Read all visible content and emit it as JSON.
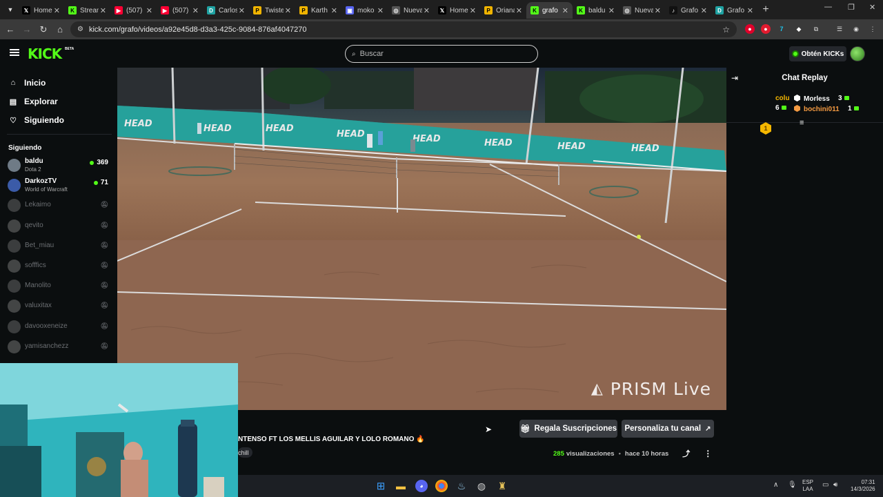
{
  "browser": {
    "tabs": [
      {
        "title": "Home",
        "icon": "x-icon",
        "color": "#000000",
        "glyph": "𝕏"
      },
      {
        "title": "Stream",
        "icon": "kick-icon",
        "color": "#53fc18",
        "glyph": "K"
      },
      {
        "title": "(507)",
        "icon": "youtube-icon",
        "color": "#ff0033",
        "glyph": "▶"
      },
      {
        "title": "(507)",
        "icon": "youtube-icon",
        "color": "#ff0033",
        "glyph": "▶"
      },
      {
        "title": "Carlos",
        "icon": "d-icon",
        "color": "#1fa2a2",
        "glyph": "D"
      },
      {
        "title": "Twister",
        "icon": "pin-icon",
        "color": "#f0b400",
        "glyph": "P"
      },
      {
        "title": "Karth",
        "icon": "pin-icon",
        "color": "#f0b400",
        "glyph": "P"
      },
      {
        "title": "moko",
        "icon": "app-icon",
        "color": "#5865f2",
        "glyph": "▣"
      },
      {
        "title": "Nueva",
        "icon": "globe-icon",
        "color": "#555555",
        "glyph": "◎"
      },
      {
        "title": "Home",
        "icon": "x-icon",
        "color": "#000000",
        "glyph": "𝕏"
      },
      {
        "title": "Oriana",
        "icon": "pin-icon",
        "color": "#f0b400",
        "glyph": "P"
      },
      {
        "title": "grafo",
        "icon": "kick-icon",
        "color": "#53fc18",
        "glyph": "K",
        "active": true
      },
      {
        "title": "baldu",
        "icon": "kick-icon",
        "color": "#53fc18",
        "glyph": "K"
      },
      {
        "title": "Nueva",
        "icon": "globe-icon",
        "color": "#555555",
        "glyph": "◎"
      },
      {
        "title": "Grafo",
        "icon": "tiktok-icon",
        "color": "#111111",
        "glyph": "♪"
      },
      {
        "title": "Grafo",
        "icon": "d-icon",
        "color": "#1fa2a2",
        "glyph": "D"
      }
    ],
    "url": "kick.com/grafo/videos/a92e45d8-d3a3-425c-9084-876af4047270"
  },
  "header": {
    "logo": "KICK",
    "beta": "BETA",
    "search_placeholder": "Buscar",
    "kicks_button": "Obtén KICKs"
  },
  "sidebar": {
    "nav": [
      {
        "label": "Inicio",
        "icon": "home-icon",
        "glyph": "⌂"
      },
      {
        "label": "Explorar",
        "icon": "compass-icon",
        "glyph": "▤"
      },
      {
        "label": "Siguiendo",
        "icon": "heart-icon",
        "glyph": "♡"
      }
    ],
    "following_title": "Siguiendo",
    "channels": [
      {
        "name": "baldu",
        "game": "Dota 2",
        "viewers": "369",
        "live": true,
        "color": "#6f7b86"
      },
      {
        "name": "DarkozTV",
        "game": "World of Warcraft",
        "viewers": "71",
        "live": true,
        "color": "#3b5ba8"
      },
      {
        "name": "Lekaimo",
        "live": false,
        "color": "#777777"
      },
      {
        "name": "qevito",
        "live": false,
        "color": "#888888"
      },
      {
        "name": "Bet_miau",
        "live": false,
        "color": "#777777"
      },
      {
        "name": "sofffics",
        "live": false,
        "color": "#888888"
      },
      {
        "name": "Manolito",
        "live": false,
        "color": "#777777"
      },
      {
        "name": "valuxitax",
        "live": false,
        "color": "#888888"
      },
      {
        "name": "davooxeneize",
        "live": false,
        "color": "#777777"
      },
      {
        "name": "yamisanchezz",
        "live": false,
        "color": "#888888"
      }
    ],
    "offline_icon": "muted-bell-icon"
  },
  "video": {
    "watermark": "PRISM Live"
  },
  "stream_info": {
    "title": "NTENSO FT LOS MELLIS AGUILAR Y LOLO ROMANO 🔥",
    "tag": "chill",
    "gift_button": "Regala Suscripciones",
    "customize_button": "Personaliza tu canal",
    "views_count": "285",
    "views_label": "visualizaciones",
    "time_ago": "hace 10 horas"
  },
  "chat": {
    "title": "Chat Replay",
    "leaderboard": [
      {
        "rank": "1",
        "name": "colu",
        "count": "6",
        "color": "#f5b700"
      },
      {
        "name": "Morless",
        "count": "3",
        "color": "#ffffff"
      },
      {
        "name": "bochini011",
        "count": "1",
        "color": "#f59b42"
      }
    ]
  },
  "taskbar": {
    "lang_line1": "ESP",
    "lang_line2": "LAA",
    "time": "07:31",
    "date": "14/3/2026"
  }
}
